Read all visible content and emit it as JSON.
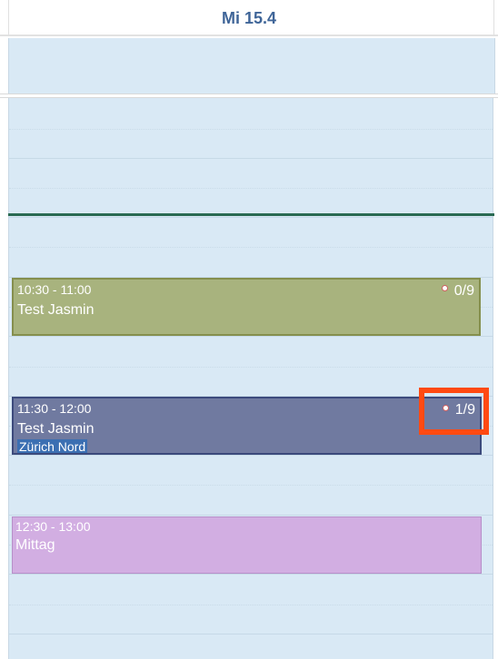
{
  "header": {
    "day_label": "Mi 15.4"
  },
  "events": [
    {
      "time": "10:30 - 11:00",
      "title": "Test Jasmin",
      "count": "0/9",
      "color": "#a8b37e"
    },
    {
      "time": "11:30 - 12:00",
      "title": "Test Jasmin",
      "count": "1/9",
      "location": "Zürich Nord",
      "color": "#707aa0"
    },
    {
      "time": "12:30 - 13:00",
      "title": "Mittag",
      "color": "#d2aee2"
    }
  ],
  "colors": {
    "now_line": "#2a6a52",
    "highlight": "#ff4a12",
    "grid_bg": "#d9e9f5"
  }
}
